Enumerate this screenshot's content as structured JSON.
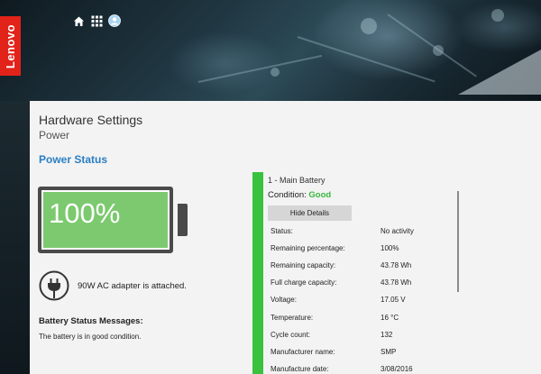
{
  "brand": {
    "logo_text": "Lenovo",
    "logo_color": "#e2231a"
  },
  "top_nav": {
    "icons": [
      "home-icon",
      "apps-grid-icon",
      "user-account-icon"
    ]
  },
  "page": {
    "title": "Hardware Settings",
    "subtitle": "Power",
    "section_title": "Power Status"
  },
  "battery_overview": {
    "percent_label": "100%",
    "charge_fraction": 1.0,
    "fill_color": "#7cc96f",
    "adapter_message": "90W AC adapter is attached.",
    "messages_heading": "Battery Status Messages:",
    "message": "The battery is in good condition."
  },
  "main_battery": {
    "title": "1 - Main Battery",
    "condition_label": "Condition:",
    "condition_value": "Good",
    "hide_details_label": "Hide Details",
    "accent_color": "#39c23e",
    "details": [
      {
        "label": "Status:",
        "value": "No activity"
      },
      {
        "label": "Remaining percentage:",
        "value": "100%"
      },
      {
        "label": "Remaining capacity:",
        "value": "43.78 Wh"
      },
      {
        "label": "Full charge capacity:",
        "value": "43.78 Wh"
      },
      {
        "label": "Voltage:",
        "value": "17.05 V"
      },
      {
        "label": "Temperature:",
        "value": "16 °C"
      },
      {
        "label": "Cycle count:",
        "value": "132"
      },
      {
        "label": "Manufacturer name:",
        "value": "SMP"
      },
      {
        "label": "Manufacture date:",
        "value": "3/08/2016"
      }
    ]
  }
}
